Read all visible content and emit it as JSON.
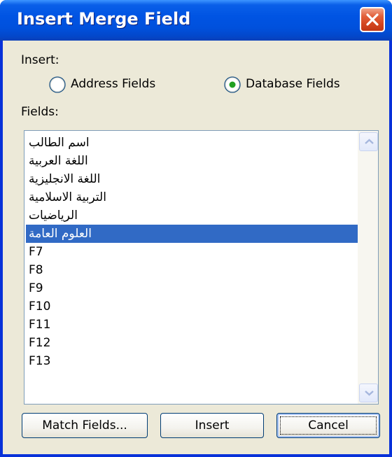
{
  "window": {
    "title": "Insert Merge Field"
  },
  "insert": {
    "label": "Insert:",
    "options": [
      {
        "label": "Address Fields",
        "selected": false
      },
      {
        "label": "Database Fields",
        "selected": true
      }
    ]
  },
  "fields": {
    "label": "Fields:",
    "items": [
      "اسم الطالب",
      "اللغة العربية",
      "اللغة الانجليزية",
      "التربية الاسلامية",
      "الرياضيات",
      "العلوم العامة",
      "F7",
      "F8",
      "F9",
      "F10",
      "F11",
      "F12",
      "F13"
    ],
    "selected_index": 5
  },
  "buttons": {
    "match_fields": "Match Fields...",
    "insert": "Insert",
    "cancel": "Cancel"
  },
  "colors": {
    "title_bar": "#0054E3",
    "selection": "#316AC5",
    "dialog_face": "#ECE9D8",
    "close_button": "#D3441E"
  }
}
